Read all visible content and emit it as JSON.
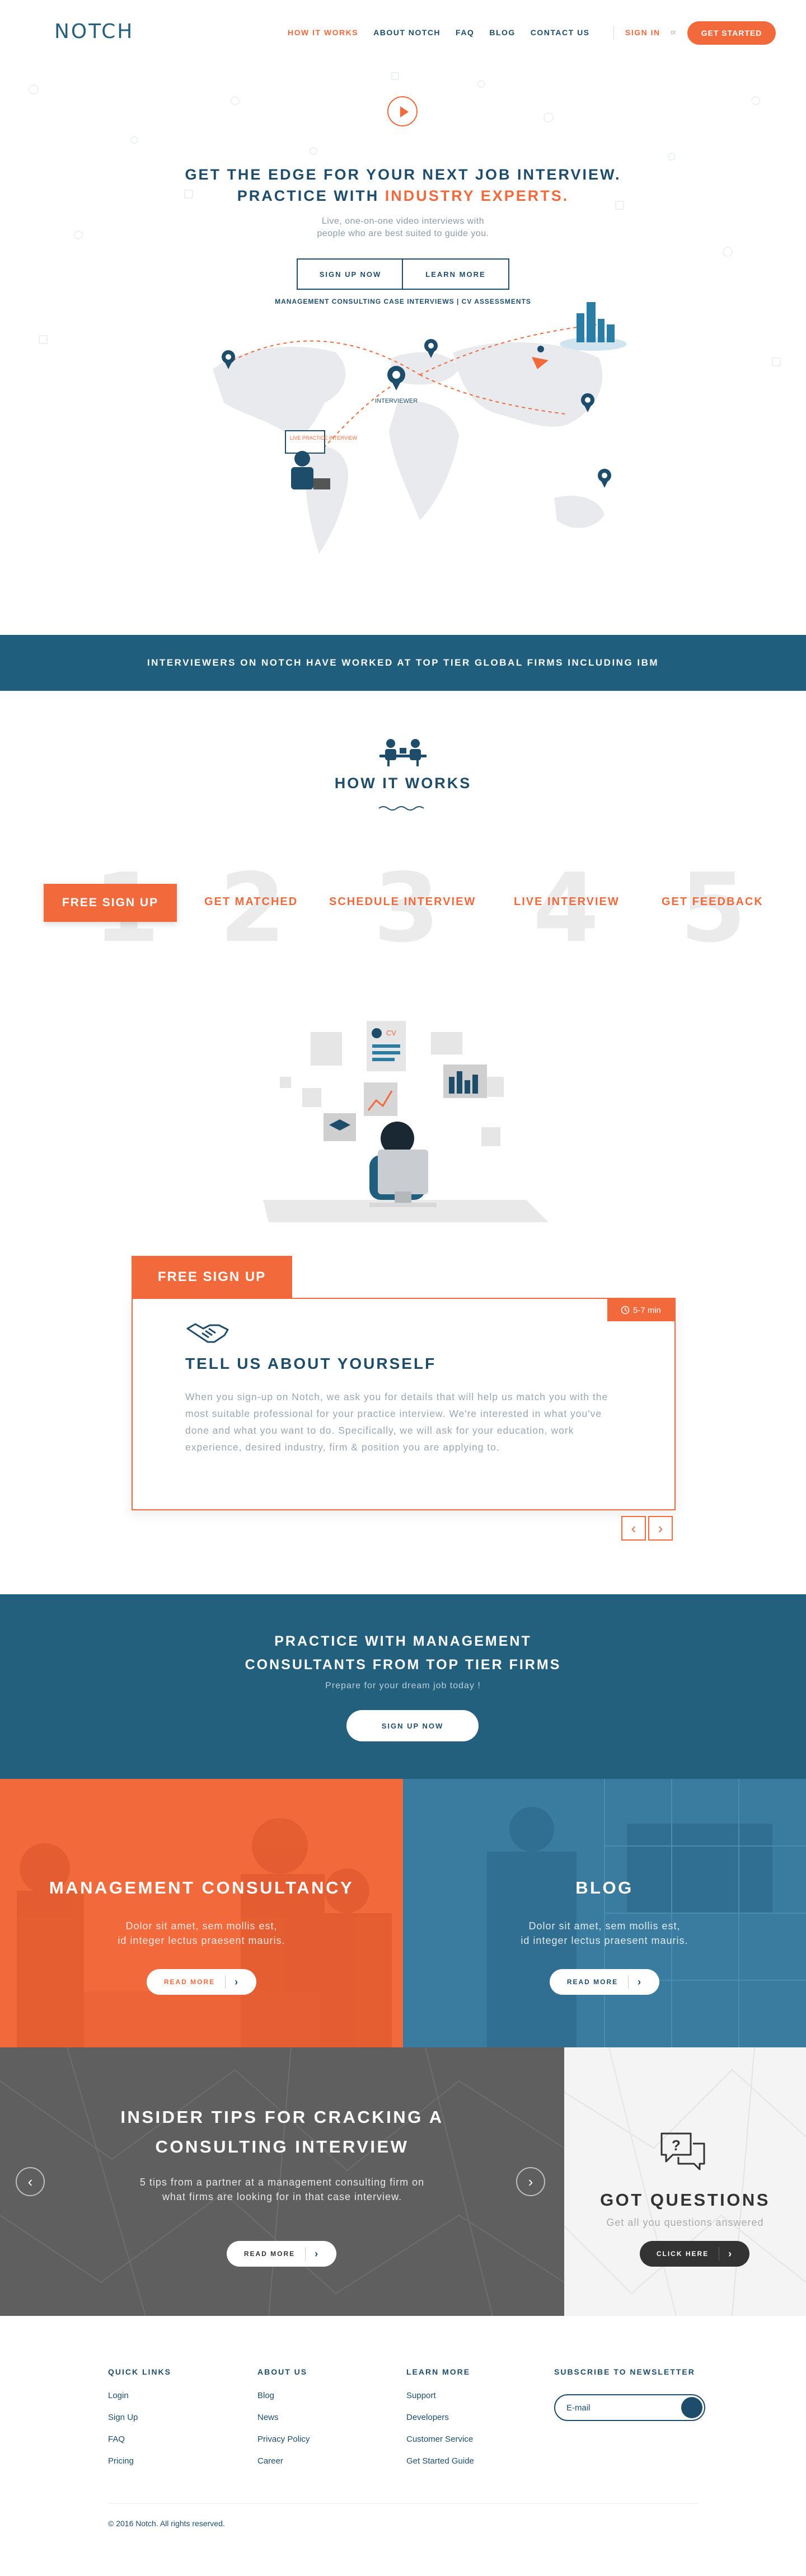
{
  "nav": {
    "logo": "NOTCH",
    "items": [
      "HOW IT WORKS",
      "ABOUT NOTCH",
      "FAQ",
      "BLOG",
      "CONTACT US"
    ],
    "signin": "SIGN IN",
    "or": "or",
    "cta": "GET STARTED"
  },
  "hero": {
    "title_line1": "GET THE EDGE FOR YOUR NEXT JOB INTERVIEW.",
    "title_line2_a": "PRACTICE WITH ",
    "title_line2_b": "INDUSTRY EXPERTS.",
    "sub1": "Live, one-on-one video interviews with",
    "sub2": "people who are best suited to guide you.",
    "btn_signup": "SIGN UP NOW",
    "btn_learn": "LEARN MORE",
    "tagline": "MANAGEMENT CONSULTING CASE INTERVIEWS | CV ASSESSMENTS",
    "map_label_interviewer": "INTERVIEWER",
    "map_label_live": "LIVE PRACTICE INTERVIEW"
  },
  "banner": {
    "text": "INTERVIEWERS ON NOTCH HAVE WORKED AT TOP TIER GLOBAL FIRMS INCLUDING IBM"
  },
  "how": {
    "title": "HOW IT WORKS",
    "steps": [
      {
        "num": "1",
        "label": "FREE SIGN UP"
      },
      {
        "num": "2",
        "label": "GET MATCHED"
      },
      {
        "num": "3",
        "label": "SCHEDULE INTERVIEW"
      },
      {
        "num": "4",
        "label": "LIVE INTERVIEW"
      },
      {
        "num": "5",
        "label": "GET FEEDBACK"
      }
    ],
    "illus_cv": "CV",
    "card_tab": "FREE SIGN UP",
    "card_time": "5-7 min",
    "card_title": "TELL US ABOUT YOURSELF",
    "card_text": "When you sign-up on Notch, we ask you for details that will help us match you with the most suitable professional for your practice interview. We're interested in what you've done and what you want to do. Specifically, we will ask for your education, work experience, desired industry, firm & position you are applying to."
  },
  "cta": {
    "line1": "PRACTICE WITH MANAGEMENT",
    "line2": "CONSULTANTS  FROM TOP TIER FIRMS",
    "sub": "Prepare for your dream job today !",
    "btn": "SIGN UP NOW"
  },
  "tiles": {
    "mc": {
      "title": "MANAGEMENT CONSULTANCY",
      "p1": "Dolor sit amet, sem mollis est,",
      "p2": "id integer lectus praesent mauris.",
      "btn": "READ MORE"
    },
    "blog": {
      "title": "BLOG",
      "p1": "Dolor sit amet, sem mollis est,",
      "p2": "id integer lectus praesent mauris.",
      "btn": "READ MORE"
    },
    "tips": {
      "title1": "INSIDER TIPS FOR CRACKING A",
      "title2": "CONSULTING INTERVIEW",
      "p1": "5 tips from a partner at a management consulting firm on",
      "p2": "what firms are looking for in that case interview.",
      "btn": "READ MORE"
    },
    "questions": {
      "title": "GOT QUESTIONS",
      "sub": "Get all you questions answered",
      "btn": "CLICK HERE"
    }
  },
  "footer": {
    "quick": {
      "title": "QUICK LINKS",
      "links": [
        "Login",
        "Sign Up",
        "FAQ",
        "Pricing"
      ]
    },
    "about": {
      "title": "ABOUT US",
      "links": [
        "Blog",
        "News",
        "Privacy Policy",
        "Career"
      ]
    },
    "learn": {
      "title": "LEARN MORE",
      "links": [
        "Support",
        "Developers",
        "Customer Service",
        "Get Started Guide"
      ]
    },
    "newsletter": {
      "title": "SUBSCRIBE TO NEWSLETTER",
      "placeholder": "E-mail"
    },
    "copyright": "© 2016 Notch. All rights reserved."
  },
  "colors": {
    "orange": "#f26a3c",
    "navy": "#1e4d6b",
    "teal": "#22607e"
  }
}
